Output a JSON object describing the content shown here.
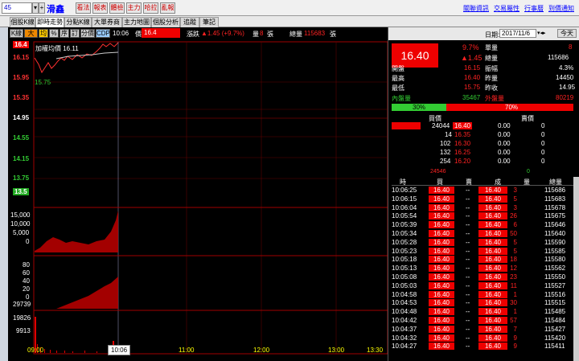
{
  "topbar": {
    "stock_code": "45",
    "stock_name": "滑鑫",
    "buttons": [
      "看法",
      "報表",
      "體檢",
      "主力",
      "哈拉",
      "亂報"
    ],
    "links": [
      "關聯資訊",
      "交易屬性",
      "行事曆",
      "到價通知"
    ]
  },
  "tabs": [
    "個股K線",
    "即時走勢",
    "分點K線",
    "大單券商",
    "主力地圖",
    "個股分析",
    "追蹤",
    "筆記"
  ],
  "chart_toolbar": {
    "buttons": [
      "K線",
      "大戶",
      "均",
      "%",
      "序",
      "訂",
      "分價",
      "CDP"
    ],
    "time": "10:06",
    "price_label": "價",
    "price": "16.4",
    "change_label": "漲跌",
    "change": "▲1.45 (+9.7%)",
    "vol_label": "量",
    "vol": "8",
    "vol_unit": "張",
    "total_label": "總量",
    "total": "115683",
    "total_unit": "張"
  },
  "price_axis": [
    "16.4",
    "16.15",
    "15.95",
    "15.75",
    "15.35",
    "14.95",
    "14.55",
    "14.15",
    "13.75",
    "13.5"
  ],
  "avg_label": "加權均價 16.11",
  "min_label": "15.75",
  "vol_axis_1": [
    "15,000",
    "10,000",
    "5,000",
    "0"
  ],
  "vol_axis_2": [
    "80",
    "60",
    "40",
    "20",
    "0"
  ],
  "vol_axis_3": [
    "29739",
    "19826",
    "9913"
  ],
  "time_axis": [
    "09:00",
    "10:06",
    "11:00",
    "12:00",
    "13:00",
    "13:30"
  ],
  "right": {
    "date_label": "日期:",
    "date": "2017/11/6",
    "today_btn": "今天",
    "big_price": "16.40",
    "pct": "9.7%",
    "change": "▲1.45",
    "single_label": "單量",
    "single": "8",
    "total_label": "總量",
    "total": "115686",
    "stats": [
      {
        "l": "開盤",
        "v": "16.15",
        "l2": "振幅",
        "v2": "4.3%"
      },
      {
        "l": "最高",
        "v": "16.40",
        "l2": "昨量",
        "v2": "14450"
      },
      {
        "l": "最低",
        "v": "15.75",
        "l2": "昨收",
        "v2": "14.95"
      },
      {
        "l": "內盤量",
        "v": "35467",
        "l2": "外盤量",
        "v2": "80219"
      }
    ],
    "ratio_in": "30%",
    "ratio_out": "70%",
    "book_headers": [
      "買價",
      "賣價"
    ],
    "book": [
      {
        "bq": "24044",
        "bp": "16.40",
        "ap": "0.00",
        "aq": "0"
      },
      {
        "bq": "14",
        "bp": "16.35",
        "ap": "0.00",
        "aq": "0"
      },
      {
        "bq": "102",
        "bp": "16.30",
        "ap": "0.00",
        "aq": "0"
      },
      {
        "bq": "132",
        "bp": "16.25",
        "ap": "0.00",
        "aq": "0"
      },
      {
        "bq": "254",
        "bp": "16.20",
        "ap": "0.00",
        "aq": "0"
      }
    ],
    "book_sum_bid": "24546",
    "book_sum_ask": "0",
    "tick_headers": [
      "時",
      "買",
      "賣",
      "成",
      "量",
      "總量"
    ],
    "ticks": [
      [
        "10:06:25",
        "16.40",
        "--",
        "16.40",
        "3",
        "115686"
      ],
      [
        "10:06:15",
        "16.40",
        "--",
        "16.40",
        "5",
        "115683"
      ],
      [
        "10:06:04",
        "16.40",
        "--",
        "16.40",
        "3",
        "115678"
      ],
      [
        "10:05:54",
        "16.40",
        "--",
        "16.40",
        "26",
        "115675"
      ],
      [
        "10:05:39",
        "16.40",
        "--",
        "16.40",
        "6",
        "115646"
      ],
      [
        "10:05:34",
        "16.40",
        "--",
        "16.40",
        "50",
        "115640"
      ],
      [
        "10:05:28",
        "16.40",
        "--",
        "16.40",
        "5",
        "115590"
      ],
      [
        "10:05:23",
        "16.40",
        "--",
        "16.40",
        "5",
        "115585"
      ],
      [
        "10:05:18",
        "16.40",
        "--",
        "16.40",
        "18",
        "115580"
      ],
      [
        "10:05:13",
        "16.40",
        "--",
        "16.40",
        "12",
        "115562"
      ],
      [
        "10:05:08",
        "16.40",
        "--",
        "16.40",
        "23",
        "115550"
      ],
      [
        "10:05:03",
        "16.40",
        "--",
        "16.40",
        "11",
        "115527"
      ],
      [
        "10:04:58",
        "16.40",
        "--",
        "16.40",
        "1",
        "115516"
      ],
      [
        "10:04:53",
        "16.40",
        "--",
        "16.40",
        "30",
        "115515"
      ],
      [
        "10:04:48",
        "16.40",
        "--",
        "16.40",
        "1",
        "115485"
      ],
      [
        "10:04:42",
        "16.40",
        "--",
        "16.40",
        "57",
        "115484"
      ],
      [
        "10:04:37",
        "16.40",
        "--",
        "16.40",
        "7",
        "115427"
      ],
      [
        "10:04:32",
        "16.40",
        "--",
        "16.40",
        "9",
        "115420"
      ],
      [
        "10:04:27",
        "16.40",
        "--",
        "16.40",
        "9",
        "115411"
      ]
    ]
  },
  "colors": {
    "up": "#ff2020",
    "down": "#20c020",
    "flat": "#ffffff",
    "bar_red": "#e00000",
    "grid": "#800000"
  }
}
